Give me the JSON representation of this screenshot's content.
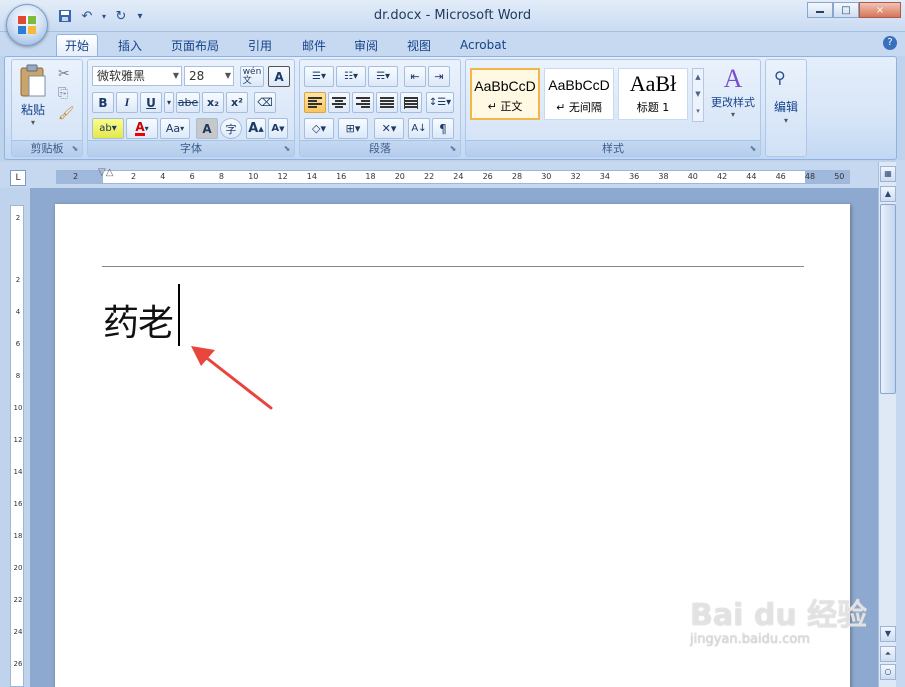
{
  "window": {
    "title": "dr.docx - Microsoft Word",
    "minimize_glyph": "0",
    "maximize_glyph": "□",
    "close_glyph": "×"
  },
  "quick_access": {
    "save_icon": "save-icon",
    "undo_icon": "undo-icon",
    "redo_icon": "redo-icon",
    "customize_glyph": "▾"
  },
  "tabs": [
    "开始",
    "插入",
    "页面布局",
    "引用",
    "邮件",
    "审阅",
    "视图",
    "Acrobat"
  ],
  "active_tab": "开始",
  "ribbon": {
    "clipboard": {
      "label": "剪贴板",
      "paste_label": "粘贴"
    },
    "font": {
      "label": "字体",
      "font_name": "微软雅黑",
      "font_size": "28",
      "bold": "B",
      "italic": "I",
      "underline": "U",
      "strike": "abe",
      "subscript": "x₂",
      "superscript": "x²",
      "grow": "A",
      "shrink": "A",
      "case": "Aa",
      "pinyin": "wén 文",
      "border_char": "A",
      "char_shade": "A",
      "enclose": "字"
    },
    "paragraph": {
      "label": "段落"
    },
    "styles": {
      "label": "样式",
      "items": [
        {
          "sample": "AaBbCcD",
          "name": "↵ 正文",
          "selected": true
        },
        {
          "sample": "AaBbCcD",
          "name": "↵ 无间隔",
          "selected": false
        },
        {
          "sample": "AaBł",
          "name": "标题 1",
          "selected": false
        }
      ],
      "change_styles": "更改样式"
    },
    "editing": {
      "label": "编辑"
    }
  },
  "ruler": {
    "corner_glyph": "L",
    "ticks": [
      "2",
      "2",
      "4",
      "6",
      "8",
      "10",
      "12",
      "14",
      "16",
      "18",
      "20",
      "22",
      "24",
      "26",
      "28",
      "30",
      "32",
      "34",
      "36",
      "38",
      "40",
      "42",
      "44",
      "46",
      "48",
      "50"
    ],
    "vticks": [
      "2",
      "2",
      "4",
      "6",
      "8",
      "10",
      "12",
      "14",
      "16",
      "18",
      "20",
      "22",
      "24",
      "26"
    ]
  },
  "document": {
    "text": "药老"
  },
  "watermark": {
    "logo": "Bai du 经验",
    "url": "jingyan.baidu.com"
  },
  "colors": {
    "accent": "#15428b",
    "ribbon_bg": "#d7e5f8",
    "doc_bg": "#8ea9cf",
    "arrow": "#e8453c"
  }
}
